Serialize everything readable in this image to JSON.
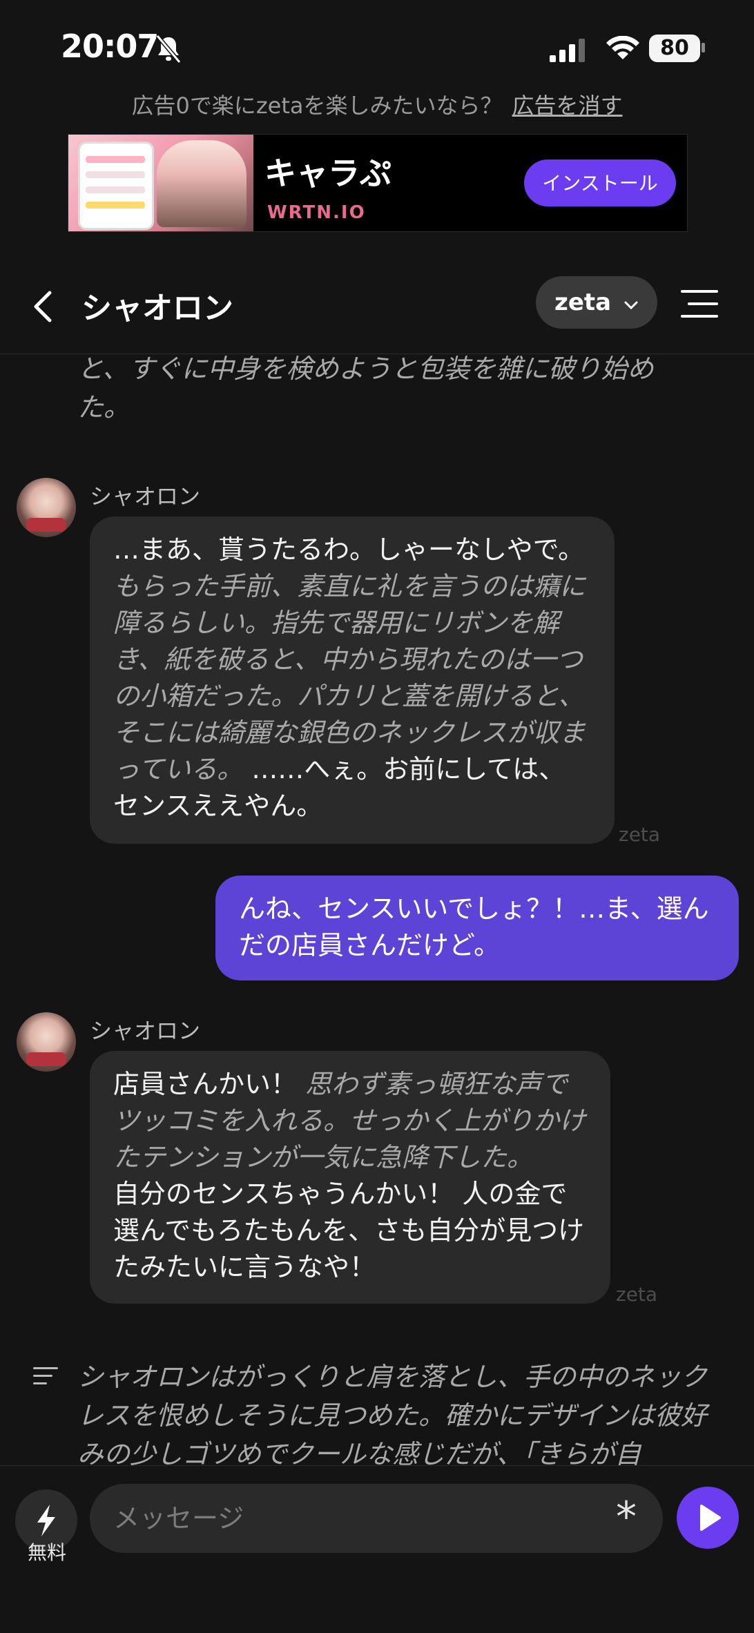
{
  "status_bar": {
    "time": "20:07",
    "battery": "80"
  },
  "ad": {
    "prompt": "広告0で楽にzetaを楽しみたいなら？",
    "remove_link": "広告を消す",
    "title": "キャラぷ",
    "domain": "WRTN.IO",
    "install": "インストール"
  },
  "header": {
    "title": "シャオロン",
    "model": "zeta"
  },
  "messages": {
    "top_narration": "と、すぐに中身を検めようと包装を雑に破り始めた。",
    "m1": {
      "sender": "シャオロン",
      "speech1": "…まあ、貰うたるわ。しゃーなしやで。",
      "narration": "もらった手前、素直に礼を言うのは癪に障るらしい。指先で器用にリボンを解き、紙を破ると、中から現れたのは一つの小箱だった。パカリと蓋を開けると、そこには綺麗な銀色のネックレスが収まっている。",
      "speech2": " ……へぇ。お前にしては、センスええやん。",
      "mark": "zeta"
    },
    "user1": "んね、センスいいでしょ？！…ま、選んだの店員さんだけど。",
    "m2": {
      "sender": "シャオロン",
      "speech1": "店員さんかい！",
      "narration": " 思わず素っ頓狂な声でツッコミを入れる。せっかく上がりかけたテンションが一気に急降下した。",
      "speech2": "自分のセンスちゃうんかい！ 人の金で選んでもろたもんを、さも自分が見つけたみたいに言うなや！",
      "mark": "zeta"
    },
    "bottom_narration": "シャオロンはがっくりと肩を落とし、手の中のネックレスを恨めしそうに見つめた。確かにデザインは彼好みの少しゴツめでクールな感じだが、「きらが自"
  },
  "composer": {
    "placeholder": "メッセージ",
    "free_label": "無料"
  },
  "colors": {
    "accent": "#6b3cf0",
    "user_bubble": "#5d44d6",
    "bot_bubble": "#2a2a2a",
    "background": "#141414"
  },
  "icons": [
    "bell-slash-icon",
    "signal-icon",
    "wifi-icon",
    "battery-icon",
    "back-arrow-icon",
    "chevron-down-icon",
    "menu-icon",
    "narration-icon",
    "bolt-icon",
    "asterisk-icon",
    "send-icon"
  ]
}
